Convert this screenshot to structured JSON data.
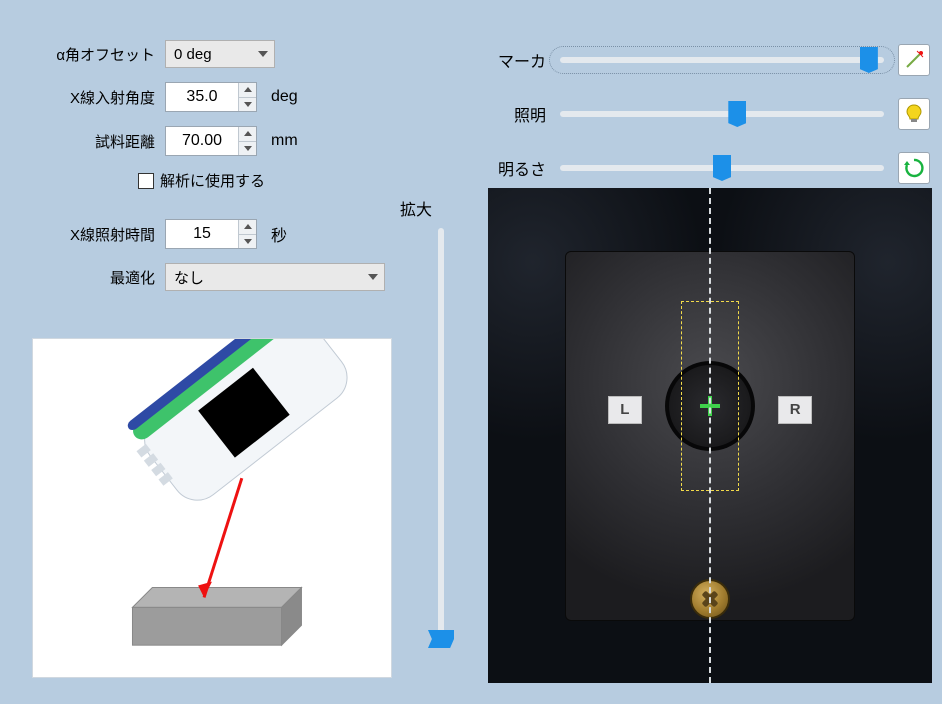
{
  "params": {
    "alpha_offset": {
      "label": "α角オフセット",
      "options": [
        "0 deg"
      ],
      "value": "0 deg"
    },
    "incident_angle": {
      "label": "X線入射角度",
      "value": "35.0",
      "unit": "deg"
    },
    "sample_distance": {
      "label": "試料距離",
      "value": "70.00",
      "unit": "mm"
    },
    "use_for_analysis": {
      "label": "解析に使用する",
      "checked": false
    },
    "exposure_time": {
      "label": "X線照射時間",
      "value": "15",
      "unit": "秒"
    },
    "optimization": {
      "label": "最適化",
      "value": "なし"
    }
  },
  "zoom": {
    "label": "拡大",
    "value": 0
  },
  "sliders": {
    "marker": {
      "label": "マーカ",
      "value": 98,
      "icon": "wand-icon"
    },
    "illumination": {
      "label": "照明",
      "value": 55,
      "icon": "bulb-icon"
    },
    "brightness": {
      "label": "明るさ",
      "value": 50,
      "icon": "refresh-icon"
    }
  },
  "camera": {
    "left_label": "L",
    "right_label": "R"
  }
}
